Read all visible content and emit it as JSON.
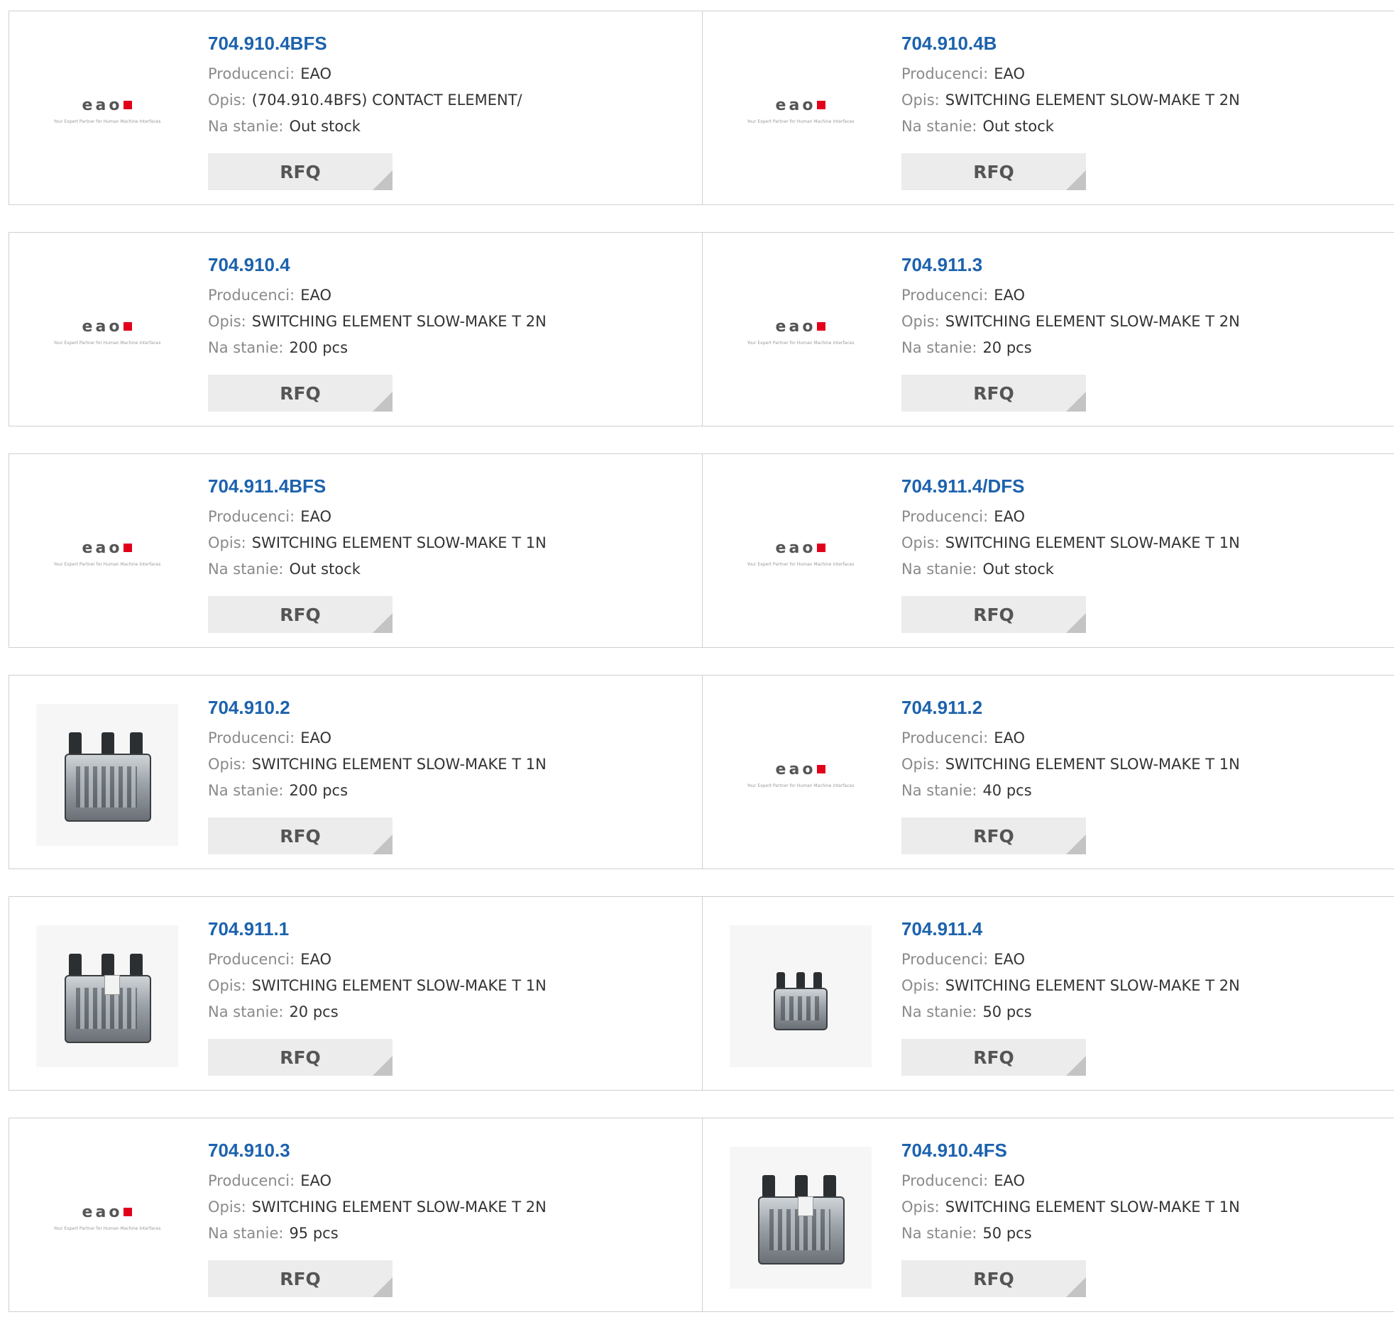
{
  "labels": {
    "manufacturer": "Producenci:",
    "description": "Opis:",
    "stock": "Na stanie:",
    "rfq": "RFQ"
  },
  "logo": {
    "word": "eao",
    "tagline": "Your Expert Partner for Human Machine Interfaces"
  },
  "products": [
    {
      "part": "704.910.4BFS",
      "manufacturer": "EAO",
      "description": "(704.910.4BFS) CONTACT ELEMENT/",
      "stock": "Out stock",
      "image": "eao-logo"
    },
    {
      "part": "704.910.4B",
      "manufacturer": "EAO",
      "description": "SWITCHING ELEMENT SLOW-MAKE T 2N",
      "stock": "Out stock",
      "image": "eao-logo"
    },
    {
      "part": "704.910.4",
      "manufacturer": "EAO",
      "description": "SWITCHING ELEMENT SLOW-MAKE T 2N",
      "stock": "200 pcs",
      "image": "eao-logo"
    },
    {
      "part": "704.911.3",
      "manufacturer": "EAO",
      "description": "SWITCHING ELEMENT SLOW-MAKE T 2N",
      "stock": "20 pcs",
      "image": "eao-logo"
    },
    {
      "part": "704.911.4BFS",
      "manufacturer": "EAO",
      "description": "SWITCHING ELEMENT SLOW-MAKE T 1N",
      "stock": "Out stock",
      "image": "eao-logo"
    },
    {
      "part": "704.911.4/DFS",
      "manufacturer": "EAO",
      "description": "SWITCHING ELEMENT SLOW-MAKE T 1N",
      "stock": "Out stock",
      "image": "eao-logo"
    },
    {
      "part": "704.910.2",
      "manufacturer": "EAO",
      "description": "SWITCHING ELEMENT SLOW-MAKE T 1N",
      "stock": "200 pcs",
      "image": "product-photo"
    },
    {
      "part": "704.911.2",
      "manufacturer": "EAO",
      "description": "SWITCHING ELEMENT SLOW-MAKE T 1N",
      "stock": "40 pcs",
      "image": "eao-logo"
    },
    {
      "part": "704.911.1",
      "manufacturer": "EAO",
      "description": "SWITCHING ELEMENT SLOW-MAKE T 1N",
      "stock": "20 pcs",
      "image": "product-photo"
    },
    {
      "part": "704.911.4",
      "manufacturer": "EAO",
      "description": "SWITCHING ELEMENT SLOW-MAKE T 2N",
      "stock": "50 pcs",
      "image": "product-photo-small"
    },
    {
      "part": "704.910.3",
      "manufacturer": "EAO",
      "description": "SWITCHING ELEMENT SLOW-MAKE T 2N",
      "stock": "95 pcs",
      "image": "eao-logo"
    },
    {
      "part": "704.910.4FS",
      "manufacturer": "EAO",
      "description": "SWITCHING ELEMENT SLOW-MAKE T 1N",
      "stock": "50 pcs",
      "image": "product-photo"
    }
  ]
}
